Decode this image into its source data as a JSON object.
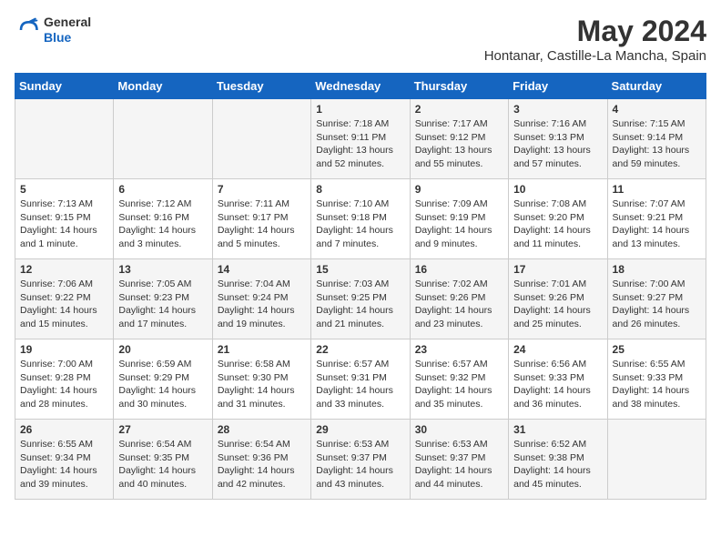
{
  "logo": {
    "general": "General",
    "blue": "Blue"
  },
  "title": "May 2024",
  "location": "Hontanar, Castille-La Mancha, Spain",
  "days_of_week": [
    "Sunday",
    "Monday",
    "Tuesday",
    "Wednesday",
    "Thursday",
    "Friday",
    "Saturday"
  ],
  "weeks": [
    [
      {
        "day": "",
        "info": ""
      },
      {
        "day": "",
        "info": ""
      },
      {
        "day": "",
        "info": ""
      },
      {
        "day": "1",
        "info": "Sunrise: 7:18 AM\nSunset: 9:11 PM\nDaylight: 13 hours and 52 minutes."
      },
      {
        "day": "2",
        "info": "Sunrise: 7:17 AM\nSunset: 9:12 PM\nDaylight: 13 hours and 55 minutes."
      },
      {
        "day": "3",
        "info": "Sunrise: 7:16 AM\nSunset: 9:13 PM\nDaylight: 13 hours and 57 minutes."
      },
      {
        "day": "4",
        "info": "Sunrise: 7:15 AM\nSunset: 9:14 PM\nDaylight: 13 hours and 59 minutes."
      }
    ],
    [
      {
        "day": "5",
        "info": "Sunrise: 7:13 AM\nSunset: 9:15 PM\nDaylight: 14 hours and 1 minute."
      },
      {
        "day": "6",
        "info": "Sunrise: 7:12 AM\nSunset: 9:16 PM\nDaylight: 14 hours and 3 minutes."
      },
      {
        "day": "7",
        "info": "Sunrise: 7:11 AM\nSunset: 9:17 PM\nDaylight: 14 hours and 5 minutes."
      },
      {
        "day": "8",
        "info": "Sunrise: 7:10 AM\nSunset: 9:18 PM\nDaylight: 14 hours and 7 minutes."
      },
      {
        "day": "9",
        "info": "Sunrise: 7:09 AM\nSunset: 9:19 PM\nDaylight: 14 hours and 9 minutes."
      },
      {
        "day": "10",
        "info": "Sunrise: 7:08 AM\nSunset: 9:20 PM\nDaylight: 14 hours and 11 minutes."
      },
      {
        "day": "11",
        "info": "Sunrise: 7:07 AM\nSunset: 9:21 PM\nDaylight: 14 hours and 13 minutes."
      }
    ],
    [
      {
        "day": "12",
        "info": "Sunrise: 7:06 AM\nSunset: 9:22 PM\nDaylight: 14 hours and 15 minutes."
      },
      {
        "day": "13",
        "info": "Sunrise: 7:05 AM\nSunset: 9:23 PM\nDaylight: 14 hours and 17 minutes."
      },
      {
        "day": "14",
        "info": "Sunrise: 7:04 AM\nSunset: 9:24 PM\nDaylight: 14 hours and 19 minutes."
      },
      {
        "day": "15",
        "info": "Sunrise: 7:03 AM\nSunset: 9:25 PM\nDaylight: 14 hours and 21 minutes."
      },
      {
        "day": "16",
        "info": "Sunrise: 7:02 AM\nSunset: 9:26 PM\nDaylight: 14 hours and 23 minutes."
      },
      {
        "day": "17",
        "info": "Sunrise: 7:01 AM\nSunset: 9:26 PM\nDaylight: 14 hours and 25 minutes."
      },
      {
        "day": "18",
        "info": "Sunrise: 7:00 AM\nSunset: 9:27 PM\nDaylight: 14 hours and 26 minutes."
      }
    ],
    [
      {
        "day": "19",
        "info": "Sunrise: 7:00 AM\nSunset: 9:28 PM\nDaylight: 14 hours and 28 minutes."
      },
      {
        "day": "20",
        "info": "Sunrise: 6:59 AM\nSunset: 9:29 PM\nDaylight: 14 hours and 30 minutes."
      },
      {
        "day": "21",
        "info": "Sunrise: 6:58 AM\nSunset: 9:30 PM\nDaylight: 14 hours and 31 minutes."
      },
      {
        "day": "22",
        "info": "Sunrise: 6:57 AM\nSunset: 9:31 PM\nDaylight: 14 hours and 33 minutes."
      },
      {
        "day": "23",
        "info": "Sunrise: 6:57 AM\nSunset: 9:32 PM\nDaylight: 14 hours and 35 minutes."
      },
      {
        "day": "24",
        "info": "Sunrise: 6:56 AM\nSunset: 9:33 PM\nDaylight: 14 hours and 36 minutes."
      },
      {
        "day": "25",
        "info": "Sunrise: 6:55 AM\nSunset: 9:33 PM\nDaylight: 14 hours and 38 minutes."
      }
    ],
    [
      {
        "day": "26",
        "info": "Sunrise: 6:55 AM\nSunset: 9:34 PM\nDaylight: 14 hours and 39 minutes."
      },
      {
        "day": "27",
        "info": "Sunrise: 6:54 AM\nSunset: 9:35 PM\nDaylight: 14 hours and 40 minutes."
      },
      {
        "day": "28",
        "info": "Sunrise: 6:54 AM\nSunset: 9:36 PM\nDaylight: 14 hours and 42 minutes."
      },
      {
        "day": "29",
        "info": "Sunrise: 6:53 AM\nSunset: 9:37 PM\nDaylight: 14 hours and 43 minutes."
      },
      {
        "day": "30",
        "info": "Sunrise: 6:53 AM\nSunset: 9:37 PM\nDaylight: 14 hours and 44 minutes."
      },
      {
        "day": "31",
        "info": "Sunrise: 6:52 AM\nSunset: 9:38 PM\nDaylight: 14 hours and 45 minutes."
      },
      {
        "day": "",
        "info": ""
      }
    ]
  ]
}
